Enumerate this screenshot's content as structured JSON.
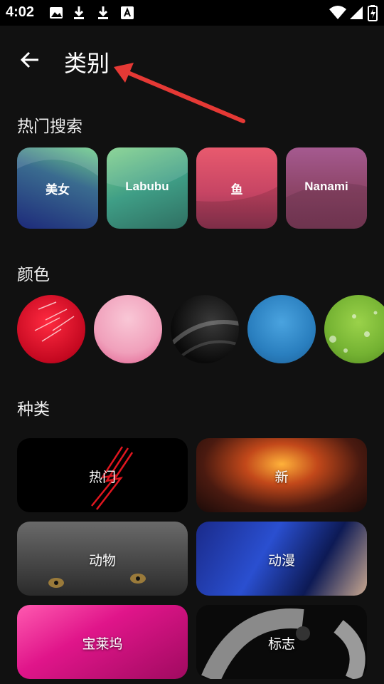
{
  "status": {
    "time": "4:02"
  },
  "header": {
    "title": "类别"
  },
  "sections": {
    "popular": "热门搜索",
    "colors": "颜色",
    "types": "种类"
  },
  "popular": [
    {
      "label": "美女",
      "color": "#2b3a8a"
    },
    {
      "label": "Labubu",
      "color": "#4aa37a"
    },
    {
      "label": "鱼",
      "color": "#d9566b"
    },
    {
      "label": "Nanami",
      "color": "#9a4a6e"
    }
  ],
  "colors": [
    {
      "name": "red",
      "color": "#d8102a"
    },
    {
      "name": "pink",
      "color": "#f2a6c0"
    },
    {
      "name": "black",
      "color": "#1a1a1a"
    },
    {
      "name": "blue",
      "color": "#2a7fbf"
    },
    {
      "name": "green",
      "color": "#7cbf3a"
    }
  ],
  "categories": [
    {
      "label": "热门"
    },
    {
      "label": "新"
    },
    {
      "label": "动物"
    },
    {
      "label": "动漫"
    },
    {
      "label": "宝莱坞"
    },
    {
      "label": "标志"
    }
  ],
  "accent": "#e53935"
}
